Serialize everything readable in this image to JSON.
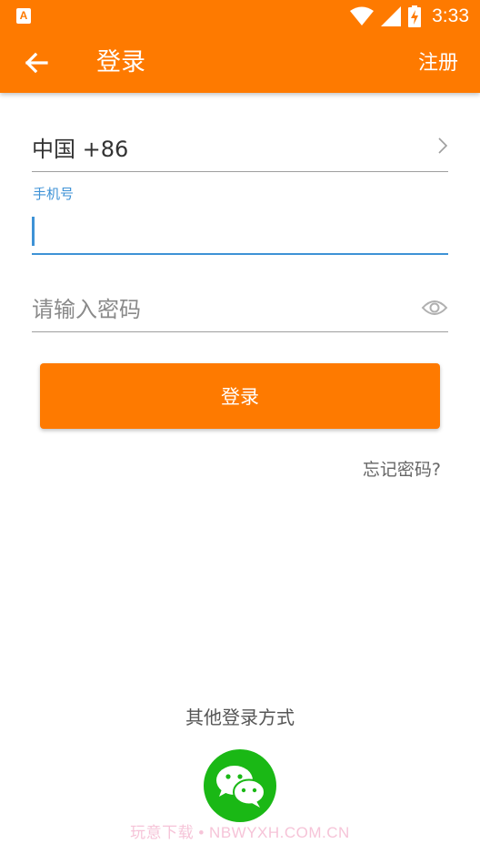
{
  "status_bar": {
    "app_icon_letter": "A",
    "time": "3:33",
    "icons": [
      "app-notification-icon",
      "wifi-icon",
      "cell-signal-icon",
      "battery-charging-icon"
    ]
  },
  "toolbar": {
    "back_icon": "arrow-left-icon",
    "title": "登录",
    "register_label": "注册"
  },
  "form": {
    "country": "中国 +86",
    "country_chevron_icon": "chevron-right-icon",
    "phone_label": "手机号",
    "phone_value": "",
    "password_placeholder": "请输入密码",
    "password_toggle_icon": "eye-icon",
    "login_label": "登录",
    "forgot_label": "忘记密码?"
  },
  "other_login": {
    "label": "其他登录方式",
    "wechat_icon": "wechat-icon"
  },
  "watermark": "玩意下载 • NBWYXH.COM.CN",
  "colors": {
    "accent": "#fe7a00",
    "focus_blue": "#3e92d6",
    "wechat_green": "#1ab815",
    "text_dark": "#333333",
    "text_muted": "#8a8a8a"
  }
}
